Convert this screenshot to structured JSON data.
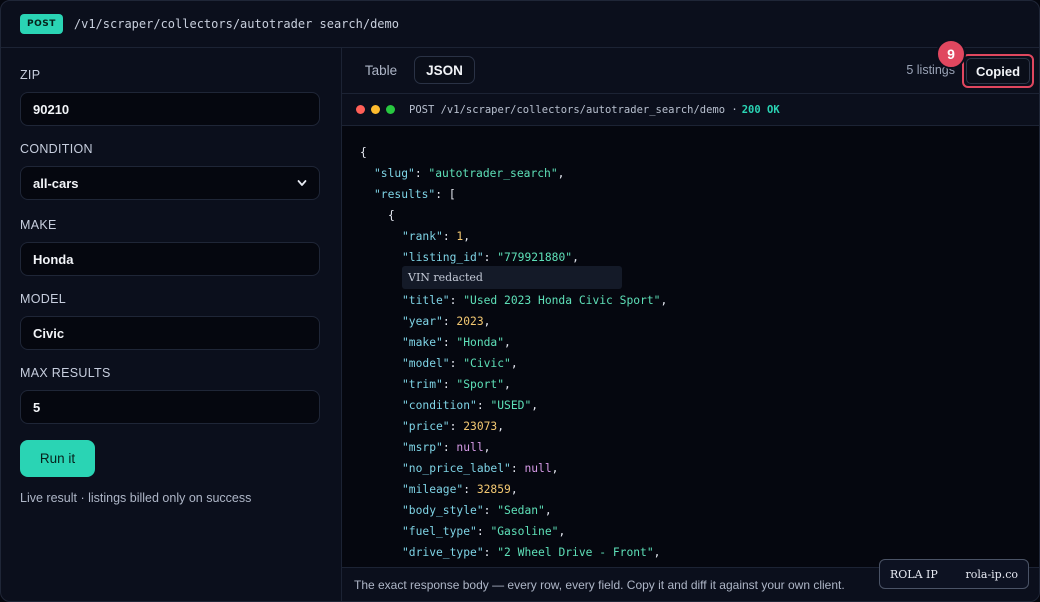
{
  "header": {
    "method": "POST",
    "endpoint": "/v1/scraper/collectors/autotrader search/demo"
  },
  "form": {
    "zip_label": "ZIP",
    "zip_value": "90210",
    "condition_label": "CONDITION",
    "condition_value": "all-cars",
    "make_label": "MAKE",
    "make_value": "Honda",
    "model_label": "MODEL",
    "model_value": "Civic",
    "max_results_label": "MAX RESULTS",
    "max_results_value": "5",
    "run_label": "Run it",
    "hint": "Live result · listings billed only on success"
  },
  "tabs": {
    "table": "Table",
    "json": "JSON"
  },
  "toolbar": {
    "listings_count": "5 listings",
    "copied_label": "Copied",
    "step_badge": "9"
  },
  "request": {
    "line": "POST /v1/scraper/collectors/autotrader_search/demo ·",
    "status": "200 OK"
  },
  "json_view": {
    "slug": "\"autotrader_search\"",
    "rank": "1",
    "listing_id": "\"779921880\"",
    "redaction_note": "VIN redacted",
    "title": "\"Used 2023 Honda Civic Sport\"",
    "year": "2023",
    "make": "\"Honda\"",
    "model": "\"Civic\"",
    "trim": "\"Sport\"",
    "condition": "\"USED\"",
    "price": "23073",
    "msrp": "null",
    "no_price_label": "null",
    "mileage": "32859",
    "body_style": "\"Sedan\"",
    "fuel_type": "\"Gasoline\"",
    "drive_type": "\"2 Wheel Drive - Front\""
  },
  "footer": {
    "text": "The exact response body — every row, every field. Copy it and diff it against your own client."
  },
  "watermark": {
    "brand": "ROLA IP",
    "domain": "rola-ip.co"
  }
}
